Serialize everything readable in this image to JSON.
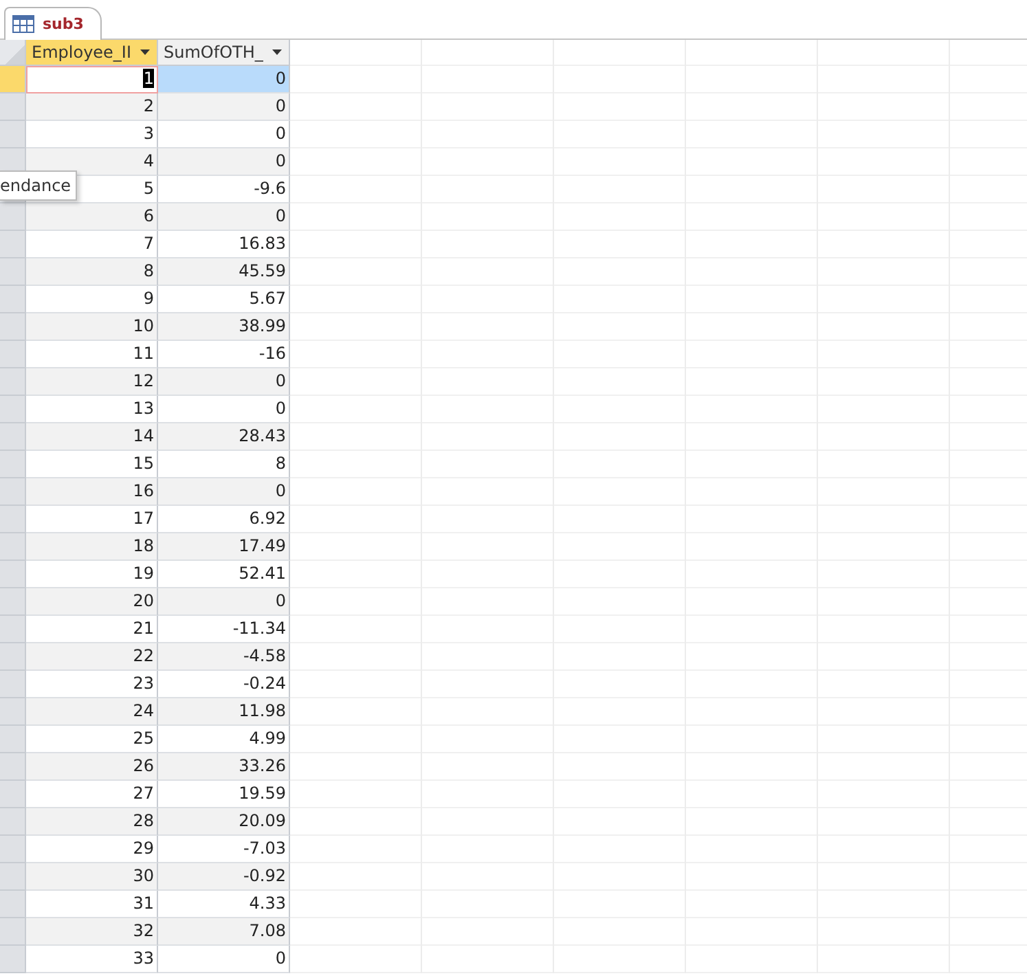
{
  "tab": {
    "label": "sub3",
    "selected": true
  },
  "columns": [
    {
      "label": "Employee_II"
    },
    {
      "label": "SumOfOTH_"
    }
  ],
  "rows": [
    {
      "selected": true,
      "cells": [
        "1",
        "0"
      ]
    },
    {
      "selected": false,
      "cells": [
        "2",
        "0"
      ]
    },
    {
      "selected": false,
      "cells": [
        "3",
        "0"
      ]
    },
    {
      "selected": false,
      "cells": [
        "4",
        "0"
      ]
    },
    {
      "selected": false,
      "cells": [
        "5",
        "-9.6"
      ]
    },
    {
      "selected": false,
      "cells": [
        "6",
        "0"
      ]
    },
    {
      "selected": false,
      "cells": [
        "7",
        "16.83"
      ]
    },
    {
      "selected": false,
      "cells": [
        "8",
        "45.59"
      ]
    },
    {
      "selected": false,
      "cells": [
        "9",
        "5.67"
      ]
    },
    {
      "selected": false,
      "cells": [
        "10",
        "38.99"
      ]
    },
    {
      "selected": false,
      "cells": [
        "11",
        "-16"
      ]
    },
    {
      "selected": false,
      "cells": [
        "12",
        "0"
      ]
    },
    {
      "selected": false,
      "cells": [
        "13",
        "0"
      ]
    },
    {
      "selected": false,
      "cells": [
        "14",
        "28.43"
      ]
    },
    {
      "selected": false,
      "cells": [
        "15",
        "8"
      ]
    },
    {
      "selected": false,
      "cells": [
        "16",
        "0"
      ]
    },
    {
      "selected": false,
      "cells": [
        "17",
        "6.92"
      ]
    },
    {
      "selected": false,
      "cells": [
        "18",
        "17.49"
      ]
    },
    {
      "selected": false,
      "cells": [
        "19",
        "52.41"
      ]
    },
    {
      "selected": false,
      "cells": [
        "20",
        "0"
      ]
    },
    {
      "selected": false,
      "cells": [
        "21",
        "-11.34"
      ]
    },
    {
      "selected": false,
      "cells": [
        "22",
        "-4.58"
      ]
    },
    {
      "selected": false,
      "cells": [
        "23",
        "-0.24"
      ]
    },
    {
      "selected": false,
      "cells": [
        "24",
        "11.98"
      ]
    },
    {
      "selected": false,
      "cells": [
        "25",
        "4.99"
      ]
    },
    {
      "selected": false,
      "cells": [
        "26",
        "33.26"
      ]
    },
    {
      "selected": false,
      "cells": [
        "27",
        "19.59"
      ]
    },
    {
      "selected": false,
      "cells": [
        "28",
        "20.09"
      ]
    },
    {
      "selected": false,
      "cells": [
        "29",
        "-7.03"
      ]
    },
    {
      "selected": false,
      "cells": [
        "30",
        "-0.92"
      ]
    },
    {
      "selected": false,
      "cells": [
        "31",
        "4.33"
      ]
    },
    {
      "selected": false,
      "cells": [
        "32",
        "7.08"
      ]
    },
    {
      "selected": false,
      "cells": [
        "33",
        "0"
      ]
    }
  ],
  "tooltip": "endance"
}
